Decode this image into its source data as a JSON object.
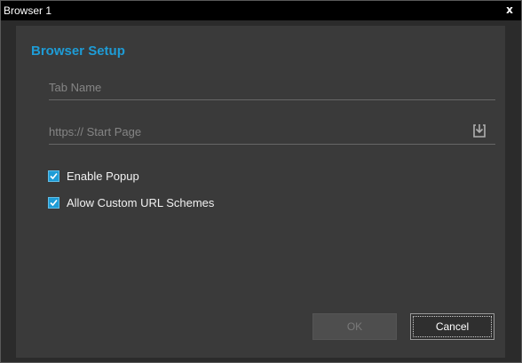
{
  "window": {
    "title": "Browser 1",
    "close_label": "x"
  },
  "dialog": {
    "heading": "Browser Setup",
    "tab_name": {
      "value": "",
      "placeholder": "Tab Name"
    },
    "start_page": {
      "value": "",
      "placeholder": "https:// Start Page",
      "icon": "download-icon"
    },
    "options": [
      {
        "label": "Enable Popup",
        "checked": true
      },
      {
        "label": "Allow Custom URL Schemes",
        "checked": true
      }
    ],
    "buttons": {
      "ok_label": "OK",
      "ok_enabled": false,
      "cancel_label": "Cancel"
    }
  },
  "colors": {
    "accent": "#1e9cd6",
    "title_bar": "#000000",
    "panel": "#3a3a3a",
    "frame": "#2b2b2b"
  }
}
